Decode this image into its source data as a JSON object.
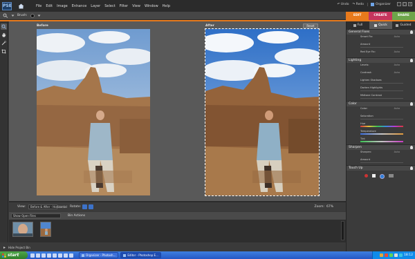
{
  "app": {
    "logo_text": "PSE",
    "menu": [
      "File",
      "Edit",
      "Image",
      "Enhance",
      "Layer",
      "Select",
      "Filter",
      "View",
      "Window",
      "Help"
    ],
    "right_items": {
      "undo": "Undo",
      "redo": "Redo",
      "organizer": "Organizer"
    }
  },
  "options_bar": {
    "brush_label": "Brush:"
  },
  "mode_tabs": [
    {
      "label": "EDIT",
      "color": "#e87a1c"
    },
    {
      "label": "CREATE",
      "color": "#c6355e"
    },
    {
      "label": "SHARE",
      "color": "#6da54a"
    }
  ],
  "canvas": {
    "before_label": "Before",
    "after_label": "After",
    "reset_label": "Reset"
  },
  "viewbar": {
    "view_label": "View:",
    "view_value": "Before & After - Horizontal",
    "rotate_label": "Rotate:",
    "zoom_label": "Zoom:",
    "zoom_value": "67%"
  },
  "bin": {
    "show_value": "Show Open Files",
    "bin_actions": "Bin Actions",
    "hide_label": "Hide Project Bin"
  },
  "panel": {
    "tabs": [
      "Full",
      "Quick",
      "Guided"
    ],
    "sections": {
      "general_fixes": {
        "title": "General Fixes",
        "rows": [
          {
            "label": "Smart Fix:",
            "value": "Auto"
          },
          {
            "label": "Amount",
            "value": ""
          },
          {
            "label": "Red Eye Fix:",
            "value": "Auto"
          }
        ]
      },
      "lighting": {
        "title": "Lighting",
        "rows": [
          {
            "label": "Levels:",
            "value": "Auto"
          },
          {
            "label": "Contrast:",
            "value": "Auto"
          },
          {
            "label": "Lighten Shadows",
            "value": ""
          },
          {
            "label": "Darken Highlights",
            "value": ""
          },
          {
            "label": "Midtone Contrast",
            "value": ""
          }
        ]
      },
      "color": {
        "title": "Color",
        "rows": [
          {
            "label": "Color:",
            "value": "Auto"
          },
          {
            "label": "Saturation",
            "value": ""
          },
          {
            "label": "Hue",
            "value": ""
          },
          {
            "label": "Temperature",
            "value": ""
          },
          {
            "label": "Tint",
            "value": ""
          }
        ]
      },
      "sharpen": {
        "title": "Sharpen",
        "rows": [
          {
            "label": "Sharpen:",
            "value": "Auto"
          },
          {
            "label": "Amount",
            "value": ""
          }
        ]
      },
      "touch_up": {
        "title": "Touch Up"
      }
    }
  },
  "taskbar": {
    "start": "start",
    "tasks": [
      "Organizer - Photosh...",
      "Editor - Photoshop E..."
    ],
    "clock": "18:12"
  }
}
